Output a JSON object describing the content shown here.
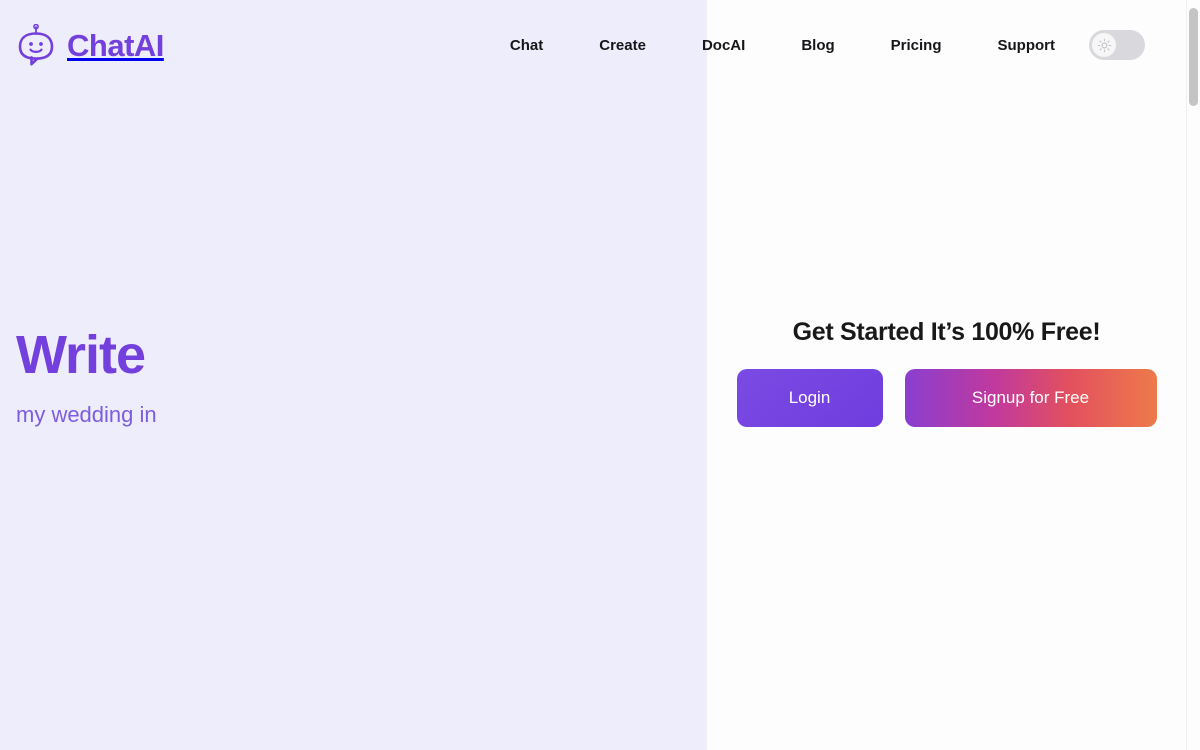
{
  "brand": {
    "name": "ChatAI",
    "icon": "chat-robot-icon",
    "color": "#7340dd"
  },
  "nav": {
    "links": [
      {
        "label": "Chat"
      },
      {
        "label": "Create"
      },
      {
        "label": "DocAI"
      },
      {
        "label": "Blog"
      },
      {
        "label": "Pricing"
      },
      {
        "label": "Support"
      }
    ],
    "theme_toggle": {
      "icon": "sun-icon",
      "state": "light",
      "track_color": "#d9d9dd",
      "knob_color": "#f6f6f7"
    }
  },
  "hero": {
    "title": "Write",
    "subtitle": "my wedding in",
    "title_color": "#7340dd",
    "subtitle_color": "#7c5ce0"
  },
  "cta": {
    "heading": "Get Started It’s 100% Free!",
    "login_label": "Login",
    "signup_label": "Signup for Free",
    "login_color": "#7140e0",
    "signup_gradient": "#8a3fd0 → #c0399e → #e2505f → #ee7a4a"
  },
  "layout": {
    "left_panel_bg": "#eeedfb",
    "right_panel_bg": "#fdfdfd"
  },
  "scrollbar": {
    "thumb_color": "#c4c4c4"
  }
}
